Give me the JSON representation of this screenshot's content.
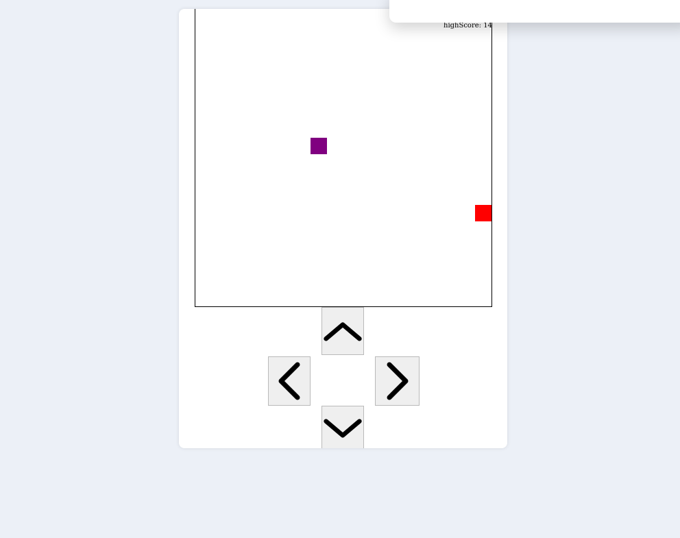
{
  "game": {
    "high_score_label": "highScore: 14",
    "food_color": "#800080",
    "snake_color": "#ff0000"
  },
  "controls": {
    "up_icon": "chevron-up-icon",
    "left_icon": "chevron-left-icon",
    "right_icon": "chevron-right-icon",
    "down_icon": "chevron-down-icon"
  }
}
